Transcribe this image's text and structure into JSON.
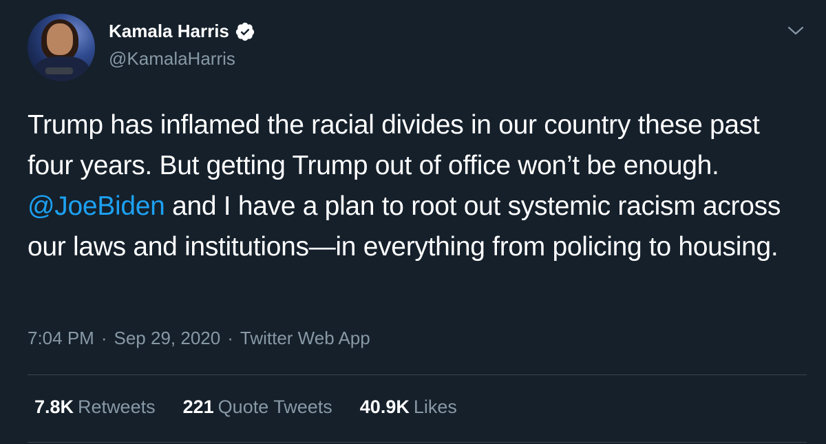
{
  "author": {
    "name": "Kamala Harris",
    "handle": "@KamalaHarris"
  },
  "tweet": {
    "text_part1": "Trump has inflamed the racial divides in our country these past four years. But getting Trump out of office won’t be enough. ",
    "mention": "@JoeBiden",
    "text_part2": " and I have a plan to root out systemic racism across our laws and institutions—in everything from policing to housing."
  },
  "meta": {
    "time": "7:04 PM",
    "separator1": "·",
    "date": "Sep 29, 2020",
    "separator2": "·",
    "source": "Twitter Web App"
  },
  "stats": {
    "retweets_count": "7.8K",
    "retweets_label": "Retweets",
    "quotes_count": "221",
    "quotes_label": "Quote Tweets",
    "likes_count": "40.9K",
    "likes_label": "Likes"
  },
  "colors": {
    "background": "#15202b",
    "accent": "#1da1f2",
    "secondary_text": "#8899a6",
    "divider": "#38444d"
  },
  "icons": {
    "verified": "verified-badge-icon",
    "menu": "chevron-down-icon"
  }
}
